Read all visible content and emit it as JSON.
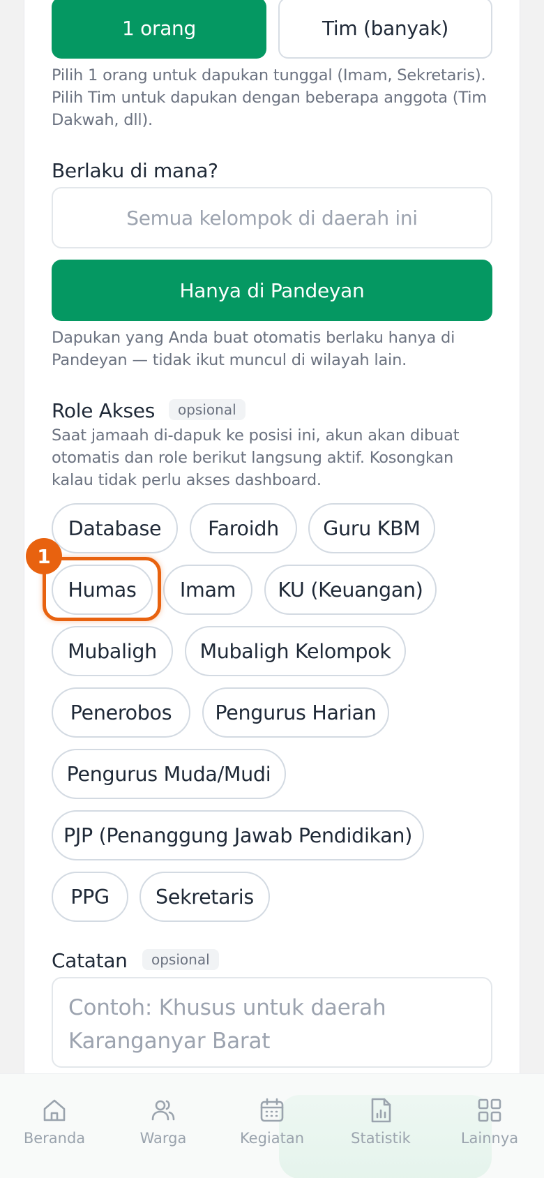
{
  "mode": {
    "single_label": "1 orang",
    "team_label": "Tim (banyak)",
    "help_line1": "Pilih 1 orang untuk dapukan tunggal (Imam, Sekretaris).",
    "help_line2": "Pilih Tim untuk dapukan dengan beberapa anggota (Tim",
    "help_line3": "Dakwah, dll)."
  },
  "scope": {
    "label": "Berlaku di mana?",
    "all_groups": "Semua kelompok di daerah ini",
    "only_here": "Hanya di Pandeyan",
    "help_line1": "Dapukan yang Anda buat otomatis berlaku hanya di",
    "help_line2": "Pandeyan — tidak ikut muncul di wilayah lain."
  },
  "roles": {
    "label": "Role Akses",
    "optional_badge": "opsional",
    "help_line1": "Saat jamaah di-dapuk ke posisi ini, akun akan dibuat",
    "help_line2": "otomatis dan role berikut langsung aktif. Kosongkan",
    "help_line3": "kalau tidak perlu akses dashboard.",
    "chips": [
      "Database",
      "Faroidh",
      "Guru KBM",
      "Humas",
      "Imam",
      "KU (Keuangan)",
      "Mubaligh",
      "Mubaligh Kelompok",
      "Penerobos",
      "Pengurus Harian",
      "Pengurus Muda/Mudi",
      "PJP (Penanggung Jawab Pendidikan)",
      "PPG",
      "Sekretaris"
    ],
    "highlight_step": "1"
  },
  "notes": {
    "label": "Catatan",
    "optional_badge": "opsional",
    "placeholder_line1": "Contoh: Khusus untuk daerah",
    "placeholder_line2": "Karanganyar Barat"
  },
  "nav": {
    "items": [
      {
        "label": "Beranda",
        "icon": "home-icon"
      },
      {
        "label": "Warga",
        "icon": "users-icon"
      },
      {
        "label": "Kegiatan",
        "icon": "calendar-icon"
      },
      {
        "label": "Statistik",
        "icon": "chart-icon"
      },
      {
        "label": "Lainnya",
        "icon": "grid-icon"
      }
    ]
  },
  "colors": {
    "primary": "#059862",
    "highlight": "#e8620f",
    "muted_text": "#6b7280",
    "nav_text": "#9aa3ad"
  }
}
